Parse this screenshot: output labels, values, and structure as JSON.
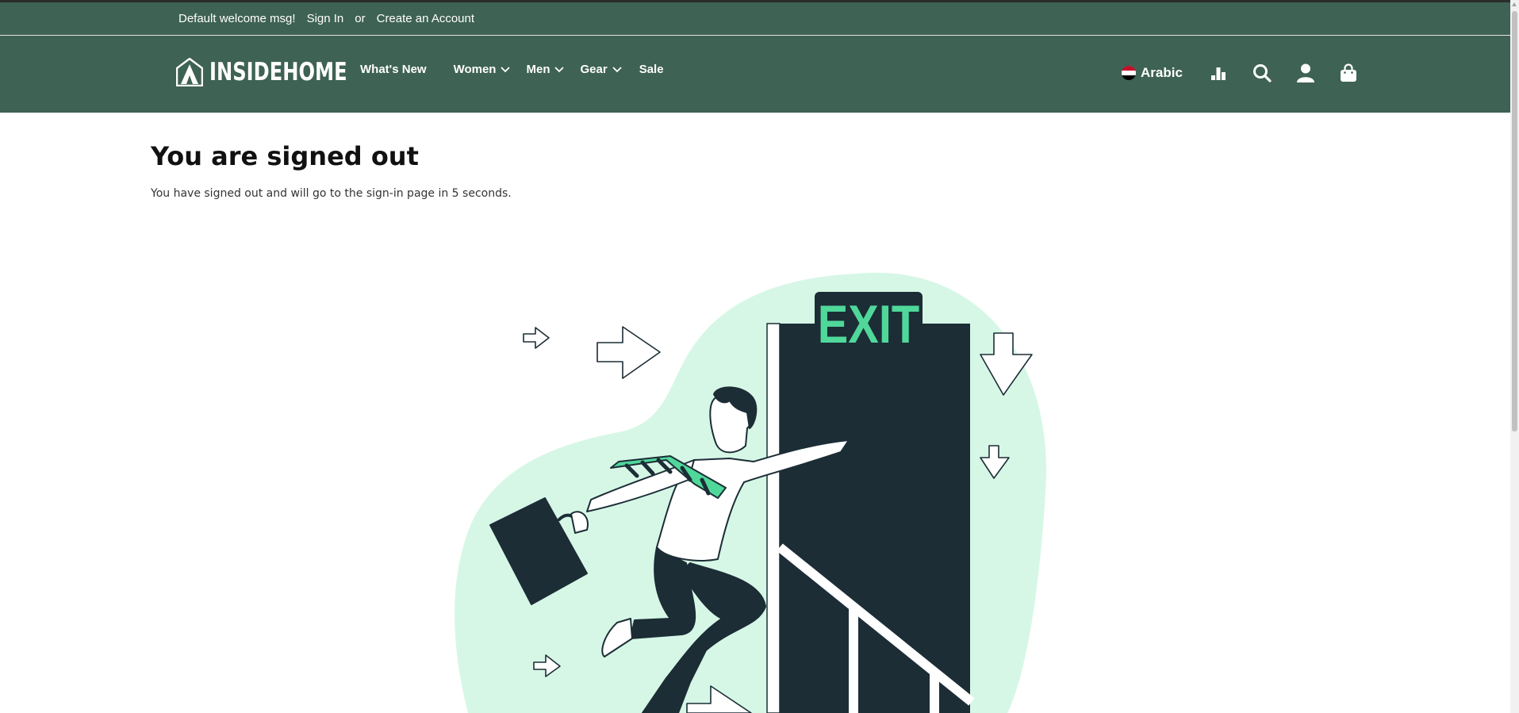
{
  "welcome_bar": {
    "message": "Default welcome msg!",
    "sign_in": "Sign In",
    "or": "or",
    "create_account": "Create an Account"
  },
  "header": {
    "logo_text": "INSIDEHOME",
    "nav": [
      {
        "label": "What's New",
        "has_dropdown": false
      },
      {
        "label": "Women",
        "has_dropdown": true
      },
      {
        "label": "Men",
        "has_dropdown": true
      },
      {
        "label": "Gear",
        "has_dropdown": true
      },
      {
        "label": "Sale",
        "has_dropdown": false
      }
    ],
    "language": "Arabic",
    "icons": [
      "compare-icon",
      "search-icon",
      "account-icon",
      "cart-icon"
    ]
  },
  "main": {
    "title": "You are signed out",
    "message": "You have signed out and will go to the sign-in page in 5 seconds."
  },
  "illustration": {
    "sign_text": "EXIT"
  },
  "colors": {
    "header_bg": "#3e6253",
    "illustration_mint": "#d6f7e6",
    "illustration_green": "#4fd89a",
    "illustration_dark": "#1c2d36"
  }
}
